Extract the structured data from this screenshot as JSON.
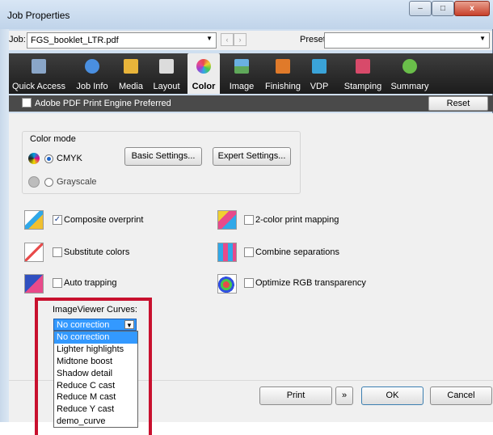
{
  "window": {
    "title": "Job Properties",
    "minimize": "–",
    "maximize": "□",
    "close": "x"
  },
  "jobbar": {
    "job_label": "Job:",
    "job_value": "FGS_booklet_LTR.pdf",
    "presets_label": "Presets:",
    "presets_value": "",
    "prev": "‹",
    "next": "›"
  },
  "tabs": [
    {
      "label": "Quick Access",
      "icon": "quick-access-icon",
      "color": "#8aa6c8"
    },
    {
      "label": "Job Info",
      "icon": "info-icon",
      "color": "#4a8fe0"
    },
    {
      "label": "Media",
      "icon": "media-icon",
      "color": "#e8b43a"
    },
    {
      "label": "Layout",
      "icon": "layout-icon",
      "color": "#dcdcdc"
    },
    {
      "label": "Color",
      "icon": "color-wheel-icon",
      "color": "#e84a8a",
      "active": true
    },
    {
      "label": "Image",
      "icon": "image-icon",
      "color": "#5fa85a"
    },
    {
      "label": "Finishing",
      "icon": "finishing-icon",
      "color": "#e07a2a"
    },
    {
      "label": "VDP",
      "icon": "vdp-icon",
      "color": "#3aa3d8"
    },
    {
      "label": "Stamping",
      "icon": "stamping-icon",
      "color": "#d84a6a"
    },
    {
      "label": "Summary",
      "icon": "checkmark-icon",
      "color": "#6abe4a"
    }
  ],
  "subbar": {
    "engine_label": "Adobe PDF Print Engine Preferred",
    "reset_label": "Reset"
  },
  "color_mode": {
    "legend": "Color mode",
    "cmyk": "CMYK",
    "grayscale": "Grayscale",
    "basic": "Basic Settings...",
    "expert": "Expert Settings..."
  },
  "options": {
    "composite_overprint": "Composite overprint",
    "substitute_colors": "Substitute colors",
    "auto_trapping": "Auto trapping",
    "two_color_mapping": "2-color print mapping",
    "combine_separations": "Combine separations",
    "optimize_rgb": "Optimize RGB transparency"
  },
  "curves": {
    "label": "ImageViewer Curves:",
    "selected": "No correction",
    "options": [
      "No correction",
      "Lighter highlights",
      "Midtone boost",
      "Shadow detail",
      "Reduce C cast",
      "Reduce M cast",
      "Reduce Y cast",
      "demo_curve"
    ]
  },
  "footer": {
    "print": "Print",
    "more": "»",
    "ok": "OK",
    "cancel": "Cancel"
  },
  "colors": {
    "accent": "#3399ff",
    "highlight_box": "#c8102e",
    "toolbar": "#2a2a2a"
  }
}
